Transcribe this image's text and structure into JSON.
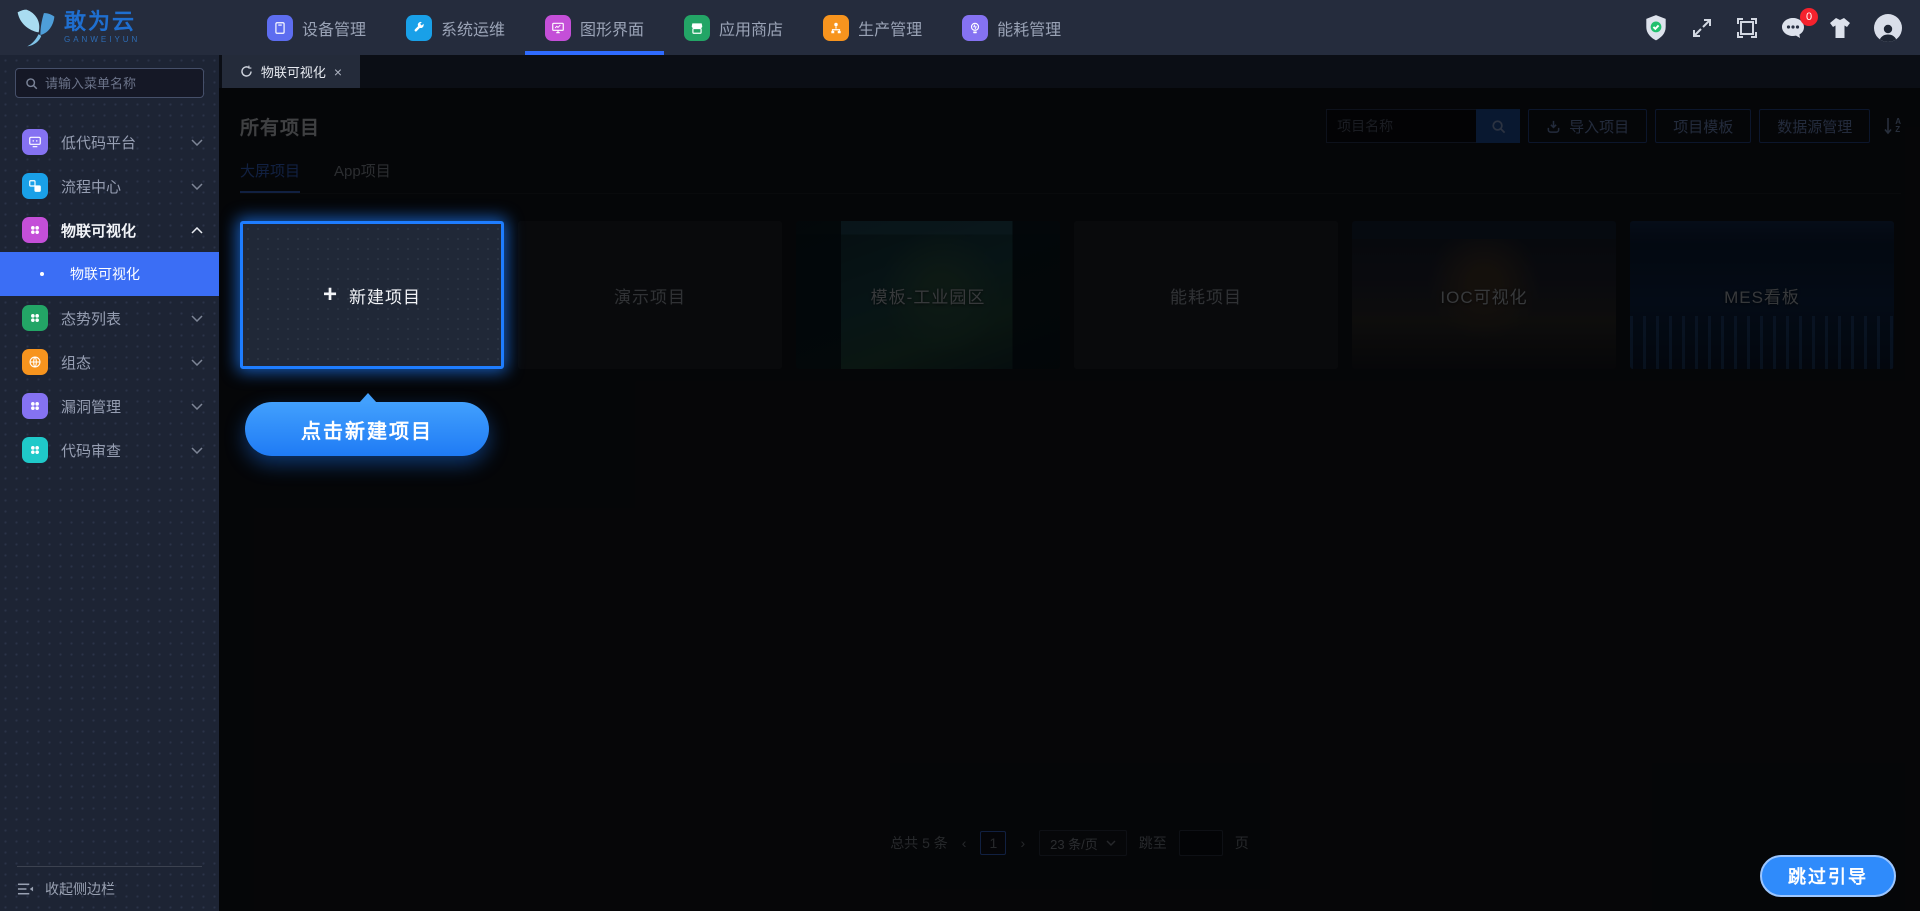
{
  "colors": {
    "accent_blue": "#3b6ef5",
    "guide_blue": "#2f8bfb",
    "nav_underline": "#2f6bff",
    "badge_red": "#f5222d"
  },
  "icons": {
    "plus": "+",
    "close": "×",
    "prev": "‹",
    "next": "›",
    "sort_a": "A",
    "sort_z": "Z"
  },
  "topnav": {
    "logo": {
      "title": "敢为云",
      "subtitle": "GANWEIYUN",
      "icon": "butterfly-logo-icon"
    },
    "items": [
      {
        "label": "设备管理",
        "icon": "device-icon"
      },
      {
        "label": "系统运维",
        "icon": "ops-wrench-icon"
      },
      {
        "label": "图形界面",
        "icon": "graphics-screen-icon",
        "active": true
      },
      {
        "label": "应用商店",
        "icon": "app-store-icon"
      },
      {
        "label": "生产管理",
        "icon": "production-icon"
      },
      {
        "label": "能耗管理",
        "icon": "energy-icon"
      }
    ],
    "notification_badge": "0"
  },
  "sidebar": {
    "search_placeholder": "请输入菜单名称",
    "items": [
      {
        "label": "低代码平台",
        "icon": "lowcode-icon"
      },
      {
        "label": "流程中心",
        "icon": "flow-icon"
      },
      {
        "label": "物联可视化",
        "icon": "clover-icon",
        "expanded": true,
        "children": [
          {
            "label": "物联可视化",
            "active": true
          }
        ]
      },
      {
        "label": "态势列表",
        "icon": "clover-icon"
      },
      {
        "label": "组态",
        "icon": "globe-icon"
      },
      {
        "label": "漏洞管理",
        "icon": "clover-icon"
      },
      {
        "label": "代码审查",
        "icon": "clover-icon"
      }
    ],
    "collapse_label": "收起侧边栏"
  },
  "tabbar": {
    "tabs": [
      {
        "label": "物联可视化"
      }
    ]
  },
  "main": {
    "title": "所有项目",
    "search_placeholder": "项目名称",
    "toolbar": {
      "import_label": "导入项目",
      "template_label": "项目模板",
      "datasource_label": "数据源管理"
    },
    "tabs": [
      {
        "label": "大屏项目",
        "active": true
      },
      {
        "label": "App项目"
      }
    ],
    "cards": [
      {
        "label": "新建项目",
        "type": "new"
      },
      {
        "label": "演示项目",
        "type": "plain"
      },
      {
        "label": "模板-工业园区",
        "type": "image"
      },
      {
        "label": "能耗项目",
        "type": "plain"
      },
      {
        "label": "IOC可视化",
        "type": "image"
      },
      {
        "label": "MES看板",
        "type": "image"
      }
    ],
    "pagination": {
      "total": "总共 5 条",
      "current_page": "1",
      "page_size": "23 条/页",
      "jump_label": "跳至",
      "page_unit": "页"
    }
  },
  "guide": {
    "tooltip": "点击新建项目",
    "skip_label": "跳过引导"
  }
}
